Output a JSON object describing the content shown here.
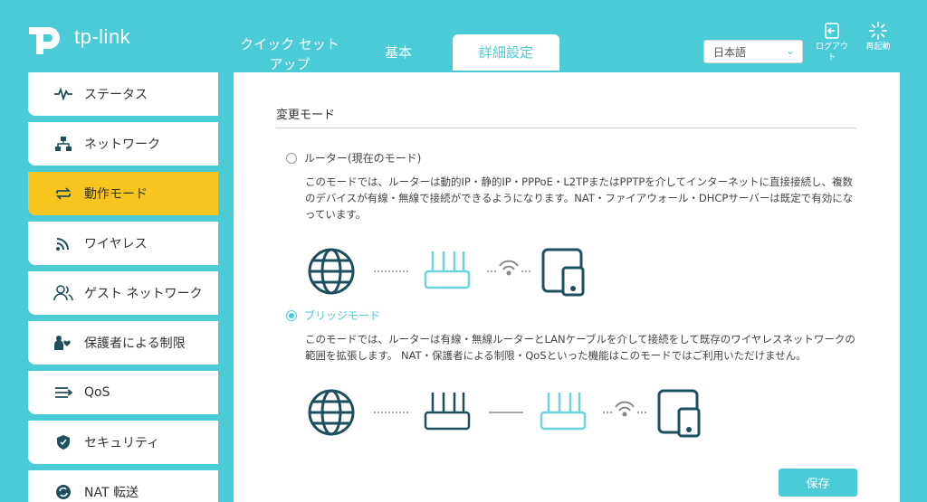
{
  "brand": {
    "logo_text": "tp-link"
  },
  "tabs": [
    {
      "label_line1": "クイック セット",
      "label_line2": "アップ"
    },
    {
      "label": "基本"
    },
    {
      "label": "詳細設定"
    }
  ],
  "language": {
    "selected": "日本語"
  },
  "header": {
    "logout_label": "ログアウト",
    "reboot_label": "再起動"
  },
  "sidebar": {
    "items": [
      {
        "label": "ステータス",
        "icon": "pulse-icon"
      },
      {
        "label": "ネットワーク",
        "icon": "network-icon"
      },
      {
        "label": "動作モード",
        "icon": "mode-switch-icon",
        "active": true
      },
      {
        "label": "ワイヤレス",
        "icon": "wireless-icon"
      },
      {
        "label": "ゲスト ネットワーク",
        "icon": "guest-icon"
      },
      {
        "label": "保護者による制限",
        "icon": "parental-icon"
      },
      {
        "label": "QoS",
        "icon": "qos-icon"
      },
      {
        "label": "セキュリティ",
        "icon": "shield-icon"
      },
      {
        "label": "NAT 転送",
        "icon": "nat-icon"
      }
    ]
  },
  "main": {
    "section_title": "変更モード",
    "modes": [
      {
        "label": "ルーター(現在のモード)",
        "selected": false,
        "description": "このモードでは、ルーターは動的IP・静的IP・PPPoE・L2TPまたはPPTPを介してインターネットに直接接続し、複数のデバイスが有線・無線で接続ができるようになります。NAT・ファイアウォール・DHCPサーバーは既定で有効になっています。"
      },
      {
        "label": "ブリッジモード",
        "selected": true,
        "description": "このモードでは、ルーターは有線・無線ルーターとLANケーブルを介して接続をして既存のワイヤレスネットワークの範囲を拡張します。 NAT・保護者による制限・QoSといった機能はこのモードではご利用いただけません。"
      }
    ],
    "save_label": "保存"
  },
  "colors": {
    "accent": "#4acbd6",
    "active": "#f7c51e",
    "dark_icon": "#1e4f5f"
  }
}
